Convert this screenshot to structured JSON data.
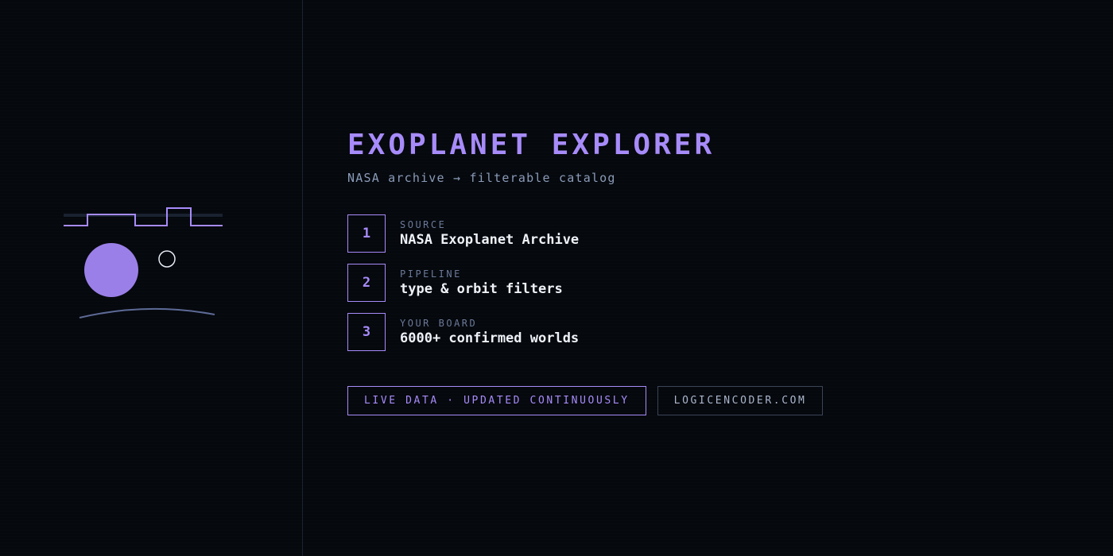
{
  "title": "EXOPLANET EXPLORER",
  "subtitle": "NASA archive → filterable catalog",
  "steps": [
    {
      "number": "1",
      "label": "SOURCE",
      "value": "NASA Exoplanet Archive"
    },
    {
      "number": "2",
      "label": "PIPELINE",
      "value": "type & orbit filters"
    },
    {
      "number": "3",
      "label": "YOUR BOARD",
      "value": "6000+ confirmed worlds"
    }
  ],
  "badges": {
    "live": "LIVE DATA · UPDATED CONTINUOUSLY",
    "site": "LOGICENCODER.COM"
  },
  "colors": {
    "accent": "#a78bfa",
    "background": "#05080d",
    "text": "#eef2f8",
    "muted": "#8a9bb8"
  }
}
